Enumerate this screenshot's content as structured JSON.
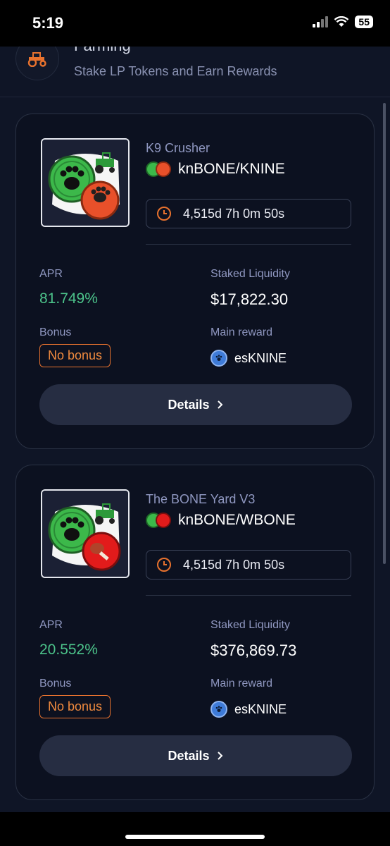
{
  "status": {
    "time": "5:19",
    "battery": "55"
  },
  "header": {
    "title": "Farming",
    "subtitle": "Stake LP Tokens and Earn Rewards"
  },
  "labels": {
    "apr": "APR",
    "staked": "Staked Liquidity",
    "bonus": "Bonus",
    "main_reward": "Main reward",
    "details": "Details"
  },
  "pools": [
    {
      "name": "K9 Crusher",
      "pair": "knBONE/KNINE",
      "timer": "4,515d 7h 0m 50s",
      "apr": "81.749%",
      "staked": "$17,822.30",
      "bonus": "No bonus",
      "reward": "esKNINE"
    },
    {
      "name": "The BONE Yard V3",
      "pair": "knBONE/WBONE",
      "timer": "4,515d 7h 0m 50s",
      "apr": "20.552%",
      "staked": "$376,869.73",
      "bonus": "No bonus",
      "reward": "esKNINE"
    }
  ],
  "colors": {
    "accent": "#e8722e",
    "apr": "#4cc38a",
    "card": "#0c1120"
  }
}
